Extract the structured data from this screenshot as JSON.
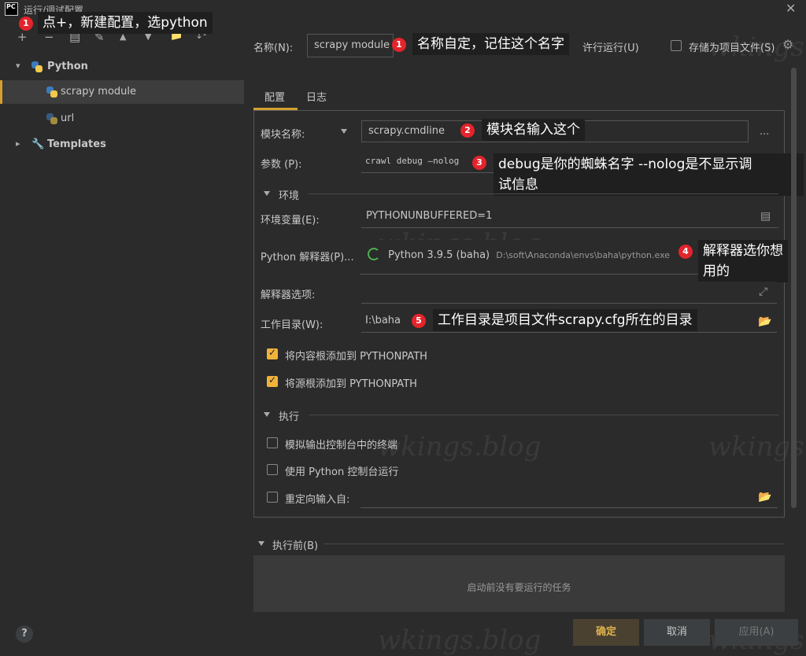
{
  "window": {
    "app_icon": "PC",
    "title": "运行/调试配置",
    "close": "✕"
  },
  "toolbar": {
    "add": "+",
    "remove": "−",
    "copy": "▤",
    "edit": "✎",
    "up": "▲",
    "down": "▼",
    "folder": "📁",
    "sort": "↓²"
  },
  "tree": {
    "python_label": "Python",
    "module_label": "scrapy module",
    "url_label": "url",
    "templates_label": "Templates"
  },
  "help_label": "?",
  "header": {
    "name_label": "名称(N):",
    "name_value": "scrapy module",
    "parallel_fragment": "许行运行(U)",
    "store_label": "存储为项目文件(S)"
  },
  "tabs": {
    "config": "配置",
    "log": "日志"
  },
  "form": {
    "module_name_label": "模块名称:",
    "module_value": "scrapy.cmdline",
    "params_label": "参数 (P):",
    "params_value": "crawl debug —nolog",
    "env_section": "环境",
    "env_var_label": "环境变量(E):",
    "env_var_value": "PYTHONUNBUFFERED=1",
    "interpreter_label": "Python 解释器(P)...",
    "interpreter_value": "Python 3.9.5 (baha)",
    "interpreter_path": "D:\\soft\\Anaconda\\envs\\baha\\python.exe",
    "interp_options_label": "解释器选项:",
    "workdir_label": "工作目录(W):",
    "workdir_value": "I:\\baha",
    "add_content_roots": "将内容根添加到 PYTHONPATH",
    "add_source_roots": "将源根添加到 PYTHONPATH",
    "exec_section": "执行",
    "emulate_terminal": "模拟输出控制台中的终端",
    "python_console": "使用 Python 控制台运行",
    "redirect_input": "重定向输入自:",
    "before_launch": "执行前(B)",
    "no_tasks": "启动前没有要运行的任务",
    "more": "..."
  },
  "checks": {
    "content_roots": true,
    "source_roots": true,
    "emulate": false,
    "console": false,
    "redirect": false,
    "store": false
  },
  "buttons": {
    "ok": "确定",
    "cancel": "取消",
    "apply": "应用(A)"
  },
  "annotations": {
    "a1_badge": "1",
    "a1_text": "点+，新建配置，选python",
    "b1_badge": "1",
    "b1_text": "名称自定，记住这个名字",
    "a2_badge": "2",
    "a2_text": "模块名输入这个",
    "a3_badge": "3",
    "a3_text_line1": "debug是你的蜘蛛名字  --nolog是不显示调",
    "a3_text_line2": "试信息",
    "a4_badge": "4",
    "a4_text_line1": "解释器选你想",
    "a4_text_line2": "用的",
    "a5_badge": "5",
    "a5_text": "工作目录是项目文件scrapy.cfg所在的目录"
  },
  "watermark": "wkings.blog",
  "colors": {
    "accent": "#d3a02f",
    "checkbox": "#f0b23a",
    "badge": "#e3242b",
    "bg": "#2b2b2b"
  }
}
